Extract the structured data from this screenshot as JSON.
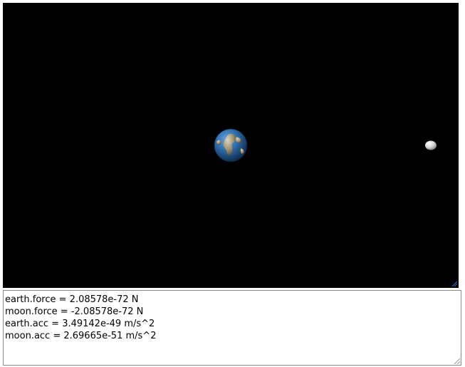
{
  "scene": {
    "background": "#000000",
    "bodies": [
      {
        "name": "earth",
        "icon": "earth-sphere",
        "colors": {
          "ocean": "#2f6fb0",
          "land": "#b8a878"
        }
      },
      {
        "name": "moon",
        "icon": "moon-sphere",
        "colors": {
          "surface": "#e8e8e8"
        }
      }
    ],
    "resize_handle_color": "#3a6fd8"
  },
  "output": {
    "lines": [
      "earth.force = 2.08578e-72 N",
      "moon.force = -2.08578e-72 N",
      "earth.acc = 3.49142e-49 m/s^2",
      "moon.acc = 2.69665e-51 m/s^2"
    ]
  }
}
